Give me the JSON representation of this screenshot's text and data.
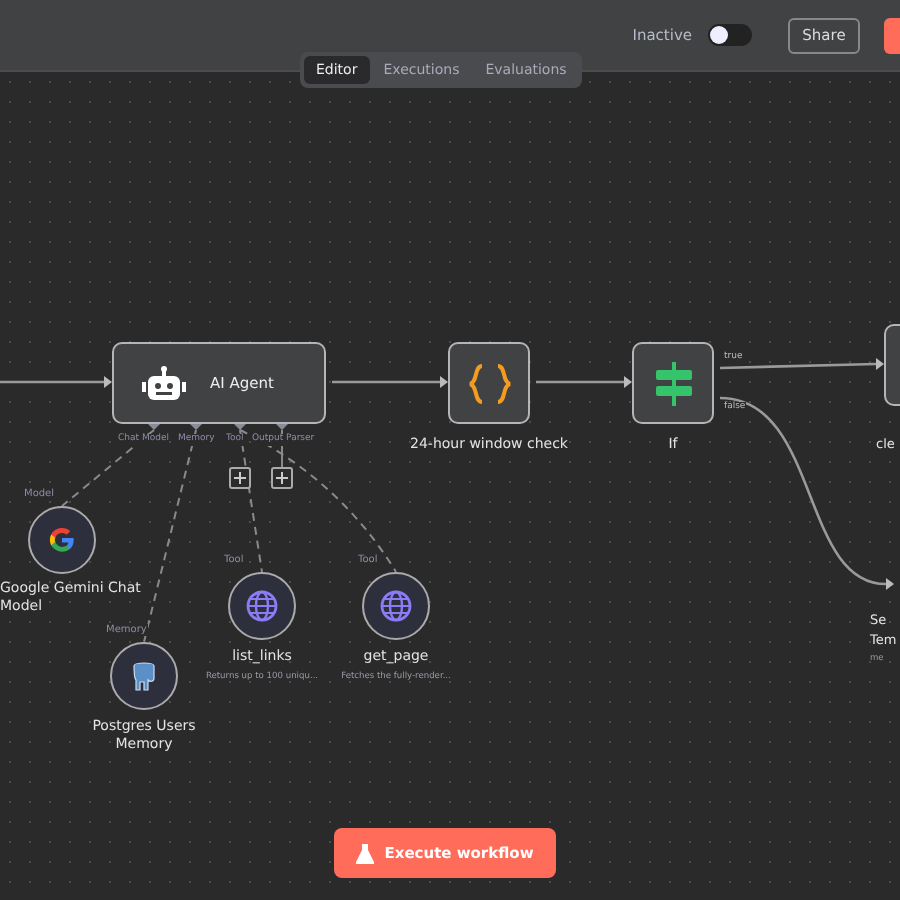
{
  "header": {
    "status_label": "Inactive",
    "active": false,
    "share_button": "Share",
    "tabs": [
      {
        "label": "Editor",
        "selected": true
      },
      {
        "label": "Executions",
        "selected": false
      },
      {
        "label": "Evaluations",
        "selected": false
      }
    ]
  },
  "nodes": [
    {
      "kind": "agent",
      "title": "AI Agent",
      "ports": [
        "Chat Model",
        "Memory",
        "Tool",
        "Output Parser"
      ]
    },
    {
      "kind": "code",
      "title": "24-hour window check"
    },
    {
      "kind": "if",
      "title": "If",
      "outputs": [
        "true",
        "false"
      ]
    },
    {
      "kind": "cut",
      "title": "cle"
    },
    {
      "kind": "cut-label",
      "lines": [
        "Se",
        "Tem"
      ],
      "subtitle": "me"
    }
  ],
  "sub_nodes": [
    {
      "kind": "model",
      "role": "Model",
      "title": "Google Gemini Chat Model"
    },
    {
      "kind": "memory",
      "role": "Memory",
      "title": "Postgres Users Memory"
    },
    {
      "kind": "tool",
      "role": "Tool",
      "title": "list_links",
      "subtitle": "Returns up to 100 uniqu..."
    },
    {
      "kind": "tool",
      "role": "Tool",
      "title": "get_page",
      "subtitle": "Fetches the fully-render..."
    }
  ],
  "execute_button": "Execute workflow"
}
